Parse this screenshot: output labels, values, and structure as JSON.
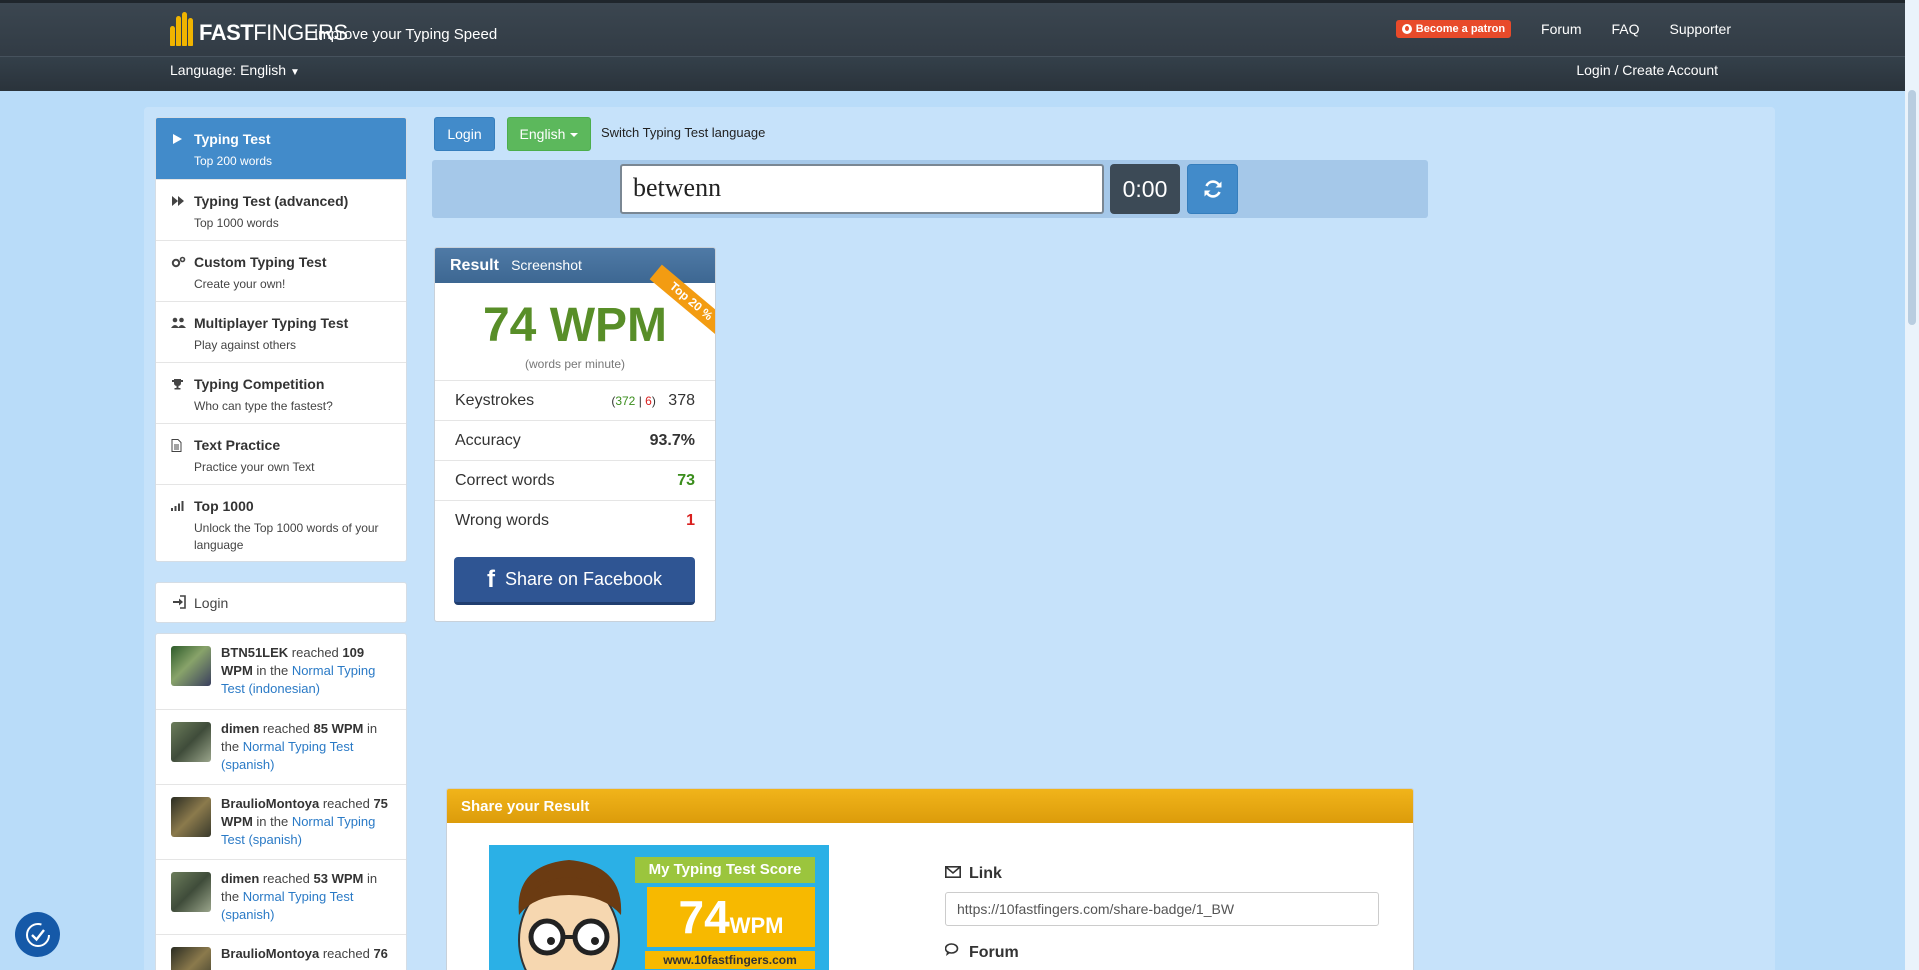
{
  "header": {
    "logo_text_bold": "FAST",
    "logo_text_thin": "FINGERS",
    "tagline": "Improve your Typing Speed",
    "patron_label": "Become a patron",
    "nav": [
      "Forum",
      "FAQ",
      "Supporter"
    ],
    "language_label": "Language: English",
    "login_create": "Login / Create Account"
  },
  "sidebar": {
    "menu": [
      {
        "title": "Typing Test",
        "sub": "Top 200 words",
        "icon": "play-icon"
      },
      {
        "title": "Typing Test (advanced)",
        "sub": "Top 1000 words",
        "icon": "fast-forward-icon"
      },
      {
        "title": "Custom Typing Test",
        "sub": "Create your own!",
        "icon": "gears-icon"
      },
      {
        "title": "Multiplayer Typing Test",
        "sub": "Play against others",
        "icon": "users-icon"
      },
      {
        "title": "Typing Competition",
        "sub": "Who can type the fastest?",
        "icon": "trophy-icon"
      },
      {
        "title": "Text Practice",
        "sub": "Practice your own Text",
        "icon": "document-icon"
      },
      {
        "title": "Top 1000",
        "sub": "Unlock the Top 1000 words of your language",
        "icon": "signal-icon"
      }
    ],
    "login_label": "Login",
    "activity": [
      {
        "user": "BTN51LEK",
        "reached": " reached ",
        "wpm": "109 WPM",
        "mid": " in the ",
        "test": "Normal Typing Test (indonesian)"
      },
      {
        "user": "dimen",
        "reached": " reached ",
        "wpm": "85 WPM",
        "mid": " in the ",
        "test": "Normal Typing Test (spanish)"
      },
      {
        "user": "BraulioMontoya",
        "reached": " reached ",
        "wpm": "75 WPM",
        "mid": " in the ",
        "test": "Normal Typing Test (spanish)"
      },
      {
        "user": "dimen",
        "reached": " reached ",
        "wpm": "53 WPM",
        "mid": " in the ",
        "test": "Normal Typing Test (spanish)"
      },
      {
        "user": "BraulioMontoya",
        "reached": " reached ",
        "wpm": "76",
        "mid": "",
        "test": ""
      }
    ]
  },
  "toolbar": {
    "login": "Login",
    "language": "English",
    "switch_lang": "Switch Typing Test language"
  },
  "typing": {
    "input_value": "betwenn",
    "timer": "0:00"
  },
  "result": {
    "title": "Result",
    "screenshot": "Screenshot",
    "ribbon": "Top 20 %",
    "wpm": "74 WPM",
    "wpm_sub": "(words per minute)",
    "keystrokes_label": "Keystrokes",
    "keystrokes_correct": "372",
    "keystrokes_sep": " | ",
    "keystrokes_wrong": "6",
    "keystrokes_total": "378",
    "accuracy_label": "Accuracy",
    "accuracy": "93.7%",
    "correct_label": "Correct words",
    "correct": "73",
    "wrong_label": "Wrong words",
    "wrong": "1",
    "facebook": "Share on Facebook"
  },
  "share": {
    "title": "Share your Result",
    "badge_title": "My Typing Test Score",
    "badge_score": "74",
    "badge_unit": "WPM",
    "badge_url": "www.10fastfingers.com",
    "link_label": "Link",
    "link_value": "https://10fastfingers.com/share-badge/1_BW",
    "forum_label": "Forum"
  },
  "colors": {
    "accent_blue": "#428bca",
    "green": "#5cb85c",
    "wpm_green": "#588e28",
    "share_orange": "#f1b41a"
  }
}
